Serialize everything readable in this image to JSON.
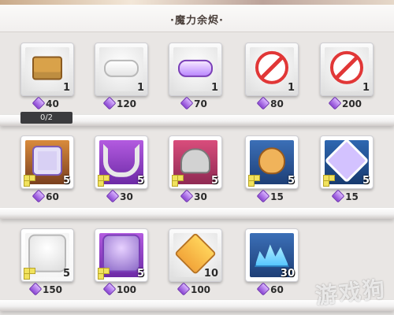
{
  "header": {
    "title": "·魔力余烬·"
  },
  "watermark": {
    "text": "游戏狗"
  },
  "currency": {
    "icon": "purple-gem-icon"
  },
  "shop": {
    "rows": [
      {
        "items": [
          {
            "rarity": "normal",
            "icon": "chest-icon",
            "quantity": "1",
            "cost": "40",
            "limit": "0/2"
          },
          {
            "rarity": "normal",
            "icon": "scroll-icon",
            "quantity": "1",
            "cost": "120"
          },
          {
            "rarity": "normal",
            "icon": "purple-scroll-icon",
            "quantity": "1",
            "cost": "70"
          },
          {
            "rarity": "normal",
            "icon": "prohibited-icon",
            "quantity": "1",
            "cost": "80"
          },
          {
            "rarity": "normal",
            "icon": "prohibited-icon",
            "quantity": "1",
            "cost": "200"
          }
        ]
      },
      {
        "items": [
          {
            "rarity": "gold",
            "icon": "token-icon",
            "quantity": "5",
            "cost": "60",
            "badge": "yellow-squares-icon"
          },
          {
            "rarity": "purple",
            "icon": "magnet-icon",
            "quantity": "5",
            "cost": "30",
            "badge": "yellow-squares-icon"
          },
          {
            "rarity": "red",
            "icon": "helmet-icon",
            "quantity": "5",
            "cost": "30",
            "badge": "yellow-squares-icon"
          },
          {
            "rarity": "blue",
            "icon": "acorn-icon",
            "quantity": "5",
            "cost": "15",
            "badge": "yellow-squares-icon"
          },
          {
            "rarity": "hex-blue",
            "icon": "emblem-icon",
            "quantity": "5",
            "cost": "15",
            "badge": "yellow-squares-icon"
          }
        ]
      },
      {
        "items": [
          {
            "rarity": "orange",
            "icon": "white-hair-portrait-icon",
            "quantity": "5",
            "cost": "150",
            "badge": "yellow-squares-icon"
          },
          {
            "rarity": "purple",
            "icon": "dark-hair-portrait-icon",
            "quantity": "5",
            "cost": "100",
            "badge": "yellow-squares-icon"
          },
          {
            "rarity": "normal",
            "icon": "golden-cube-icon",
            "quantity": "10",
            "cost": "100"
          },
          {
            "rarity": "blue",
            "icon": "ice-crystal-icon",
            "quantity": "30",
            "cost": "60"
          }
        ]
      }
    ]
  }
}
